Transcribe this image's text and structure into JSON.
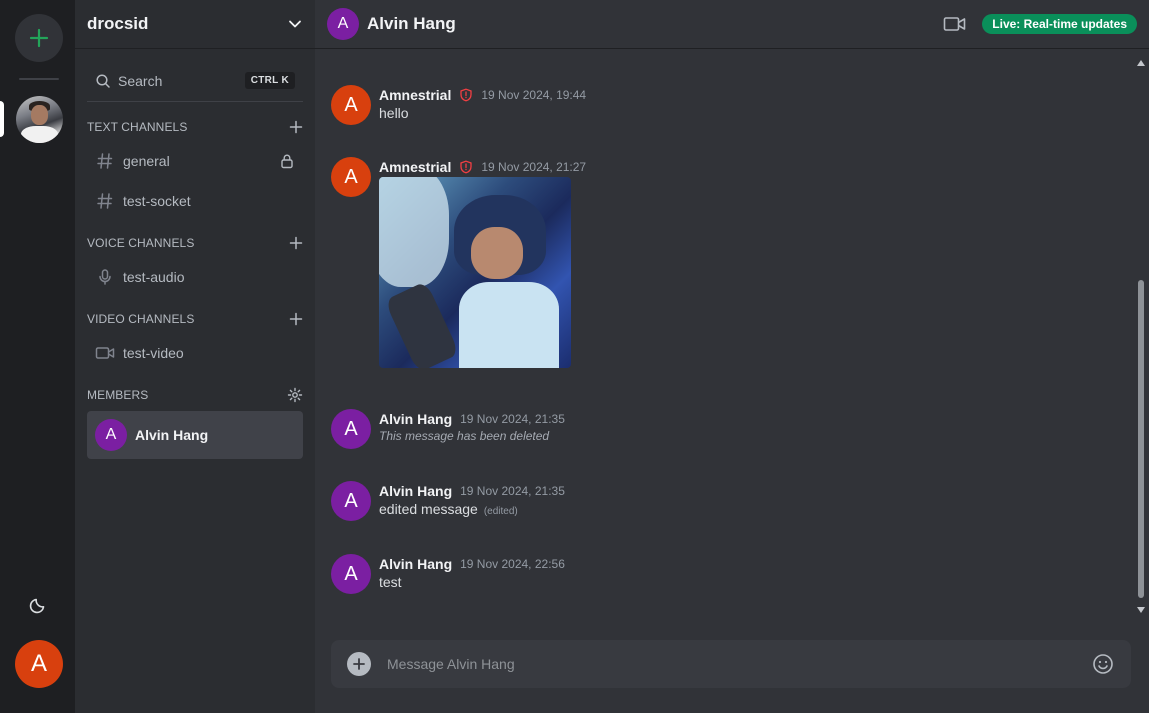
{
  "server": {
    "name": "drocsid",
    "search_label": "Search",
    "search_shortcut": "CTRL K"
  },
  "sections": {
    "text": "TEXT CHANNELS",
    "voice": "VOICE CHANNELS",
    "video": "VIDEO CHANNELS",
    "members": "MEMBERS"
  },
  "channels": {
    "text": [
      {
        "name": "general",
        "locked": true
      },
      {
        "name": "test-socket",
        "locked": false
      }
    ],
    "voice": [
      {
        "name": "test-audio"
      }
    ],
    "video": [
      {
        "name": "test-video"
      }
    ]
  },
  "members": [
    {
      "name": "Alvin Hang",
      "initial": "A",
      "color": "#7b1fa2"
    }
  ],
  "current_user": {
    "initial": "A",
    "color": "#d8400e"
  },
  "chat": {
    "title": "Alvin Hang",
    "initial": "A",
    "live_badge": "Live: Real-time updates",
    "composer_placeholder": "Message Alvin Hang"
  },
  "messages": [
    {
      "author": "Amnestrial",
      "initial": "A",
      "time": "19 Nov 2024, 19:44",
      "admin": true,
      "text": "hello"
    },
    {
      "author": "Amnestrial",
      "initial": "A",
      "time": "19 Nov 2024, 21:27",
      "admin": true,
      "text": "",
      "attachment": "image"
    },
    {
      "author": "Alvin Hang",
      "initial": "A",
      "time": "19 Nov 2024, 21:35",
      "admin": false,
      "text": "This message has been deleted",
      "deleted": true
    },
    {
      "author": "Alvin Hang",
      "initial": "A",
      "time": "19 Nov 2024, 21:35",
      "admin": false,
      "text": "edited message",
      "edited": "(edited)"
    },
    {
      "author": "Alvin Hang",
      "initial": "A",
      "time": "19 Nov 2024, 22:56",
      "admin": false,
      "text": "test"
    }
  ],
  "colors": {
    "accent_green": "#23a55a",
    "live_badge": "#0a8f5a",
    "admin_shield": "#f23f43"
  }
}
